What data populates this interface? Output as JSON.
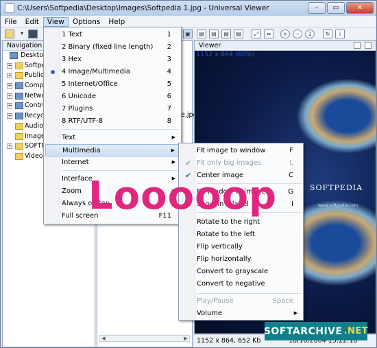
{
  "window": {
    "title": "C:\\Users\\Softpedia\\Desktop\\Images\\Softpedia 1.jpg - Universal Viewer",
    "min_label": "–",
    "max_label": "▭",
    "close_label": "✕"
  },
  "menubar": [
    "File",
    "Edit",
    "View",
    "Options",
    "Help"
  ],
  "navigation": {
    "header": "Navigation",
    "items": [
      "Desktop",
      "Softpedia",
      "Public",
      "Computer",
      "Network",
      "Control Panel",
      "Recycle Bin",
      "Audio",
      "Images",
      "SOFTPEDIA",
      "Videos"
    ]
  },
  "filelist": {
    "visible_name": "ge.jpg"
  },
  "viewer": {
    "header": "Viewer",
    "image_info": "1152 x 864 (60%)",
    "brand": "SOFTPEDIA",
    "url": "www.softpedia.com"
  },
  "status": {
    "dimensions": "1152 x 864, 652 Kb",
    "date": "18/10/2004 15:22:18"
  },
  "view_menu": {
    "modes": [
      {
        "label": "1 Text",
        "key": "1"
      },
      {
        "label": "2 Binary (fixed line length)",
        "key": "2"
      },
      {
        "label": "3 Hex",
        "key": "3"
      },
      {
        "label": "4 Image/Multimedia",
        "key": "4",
        "selected": true
      },
      {
        "label": "5 Internet/Office",
        "key": "5"
      },
      {
        "label": "6 Unicode",
        "key": "6"
      },
      {
        "label": "7 Plugins",
        "key": "7"
      },
      {
        "label": "8 RTF/UTF-8",
        "key": "8"
      }
    ],
    "submenus": [
      "Text",
      "Multimedia",
      "Internet"
    ],
    "other": [
      {
        "label": "Interface",
        "key": ""
      },
      {
        "label": "Zoom",
        "key": ""
      },
      {
        "label": "Always on top",
        "key": ""
      },
      {
        "label": "Full screen",
        "key": "F11"
      }
    ]
  },
  "multimedia_menu": {
    "group1": [
      {
        "label": "Fit image to window",
        "key": "F",
        "checked": false,
        "disabled": false
      },
      {
        "label": "Fit only big images",
        "key": "L",
        "checked": true,
        "disabled": true
      },
      {
        "label": "Center image",
        "key": "C",
        "checked": true,
        "disabled": false
      }
    ],
    "group2": [
      {
        "label": "Fit window to image",
        "key": "G",
        "checked": false,
        "disabled": false
      },
      {
        "label": "Show in a label",
        "key": "I",
        "checked": true,
        "disabled": false
      }
    ],
    "group3": [
      "Rotate to the right",
      "Rotate to the left",
      "Flip vertically",
      "Flip horizontally",
      "Convert to grayscale",
      "Convert to negative"
    ],
    "group4": [
      {
        "label": "Play/Pause",
        "key": "Space",
        "disabled": true
      },
      {
        "label": "Volume",
        "key": "",
        "disabled": false
      }
    ]
  },
  "overlay_text": "Looooop",
  "watermark": {
    "main": "SOFTARCHIVE",
    "tld": ".NET"
  },
  "colors": {
    "highlight": "#cddff5",
    "overlay": "#e1267f",
    "checkmark": "#2f64c4"
  }
}
